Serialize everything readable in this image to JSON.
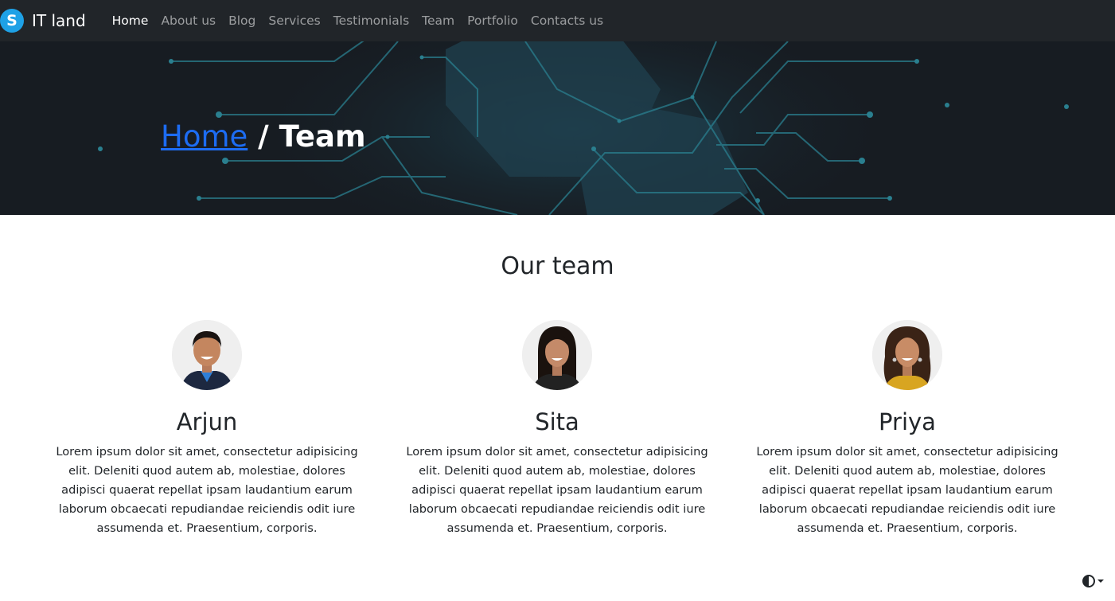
{
  "navbar": {
    "brand_logo_letter": "S",
    "brand_name": "IT land",
    "links": [
      "Home",
      "About us",
      "Blog",
      "Services",
      "Testimonials",
      "Team",
      "Portfolio",
      "Contacts us"
    ],
    "active_link": "Home"
  },
  "hero": {
    "breadcrumb_home": "Home",
    "breadcrumb_separator": "/",
    "breadcrumb_current": "Team"
  },
  "team": {
    "title": "Our team",
    "members": [
      {
        "name": "Arjun",
        "bio": "Lorem ipsum dolor sit amet, consectetur adipisicing elit. Deleniti quod autem ab, molestiae, dolores adipisci quaerat repellat ipsam laudantium earum laborum obcaecati repudiandae reiciendis odit iure assumenda et. Praesentium, corporis."
      },
      {
        "name": "Sita",
        "bio": "Lorem ipsum dolor sit amet, consectetur adipisicing elit. Deleniti quod autem ab, molestiae, dolores adipisci quaerat repellat ipsam laudantium earum laborum obcaecati repudiandae reiciendis odit iure assumenda et. Praesentium, corporis."
      },
      {
        "name": "Priya",
        "bio": "Lorem ipsum dolor sit amet, consectetur adipisicing elit. Deleniti quod autem ab, molestiae, dolores adipisci quaerat repellat ipsam laudantium earum laborum obcaecati repudiandae reiciendis odit iure assumenda et. Praesentium, corporis."
      }
    ]
  },
  "icons": {
    "brand": "skype-logo-icon",
    "theme_toggle": "contrast-half-circle-icon",
    "theme_caret": "caret-down-icon"
  },
  "colors": {
    "navbar_bg": "#212529",
    "hero_bg": "#171c22",
    "link_blue": "#1d6cf2",
    "brand_blue": "#1ea1e6",
    "circuit_teal": "#2a7f8f"
  }
}
